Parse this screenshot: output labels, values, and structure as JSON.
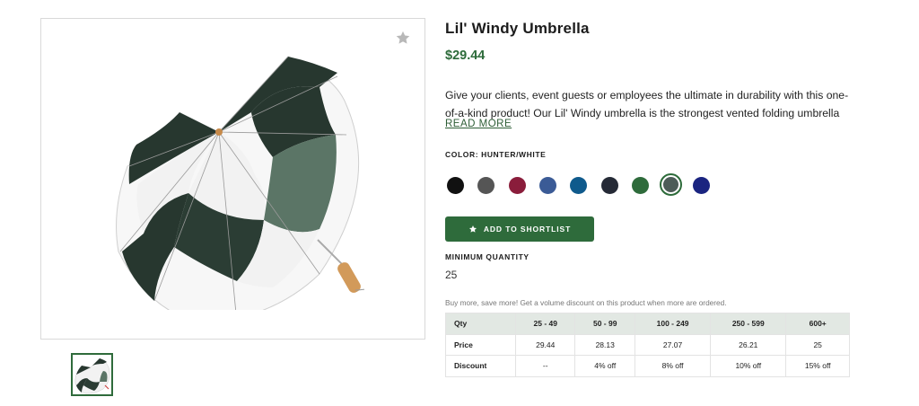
{
  "product": {
    "title": "Lil' Windy Umbrella",
    "price": "$29.44",
    "description": "Give your clients, event guests or employees the ultimate in durability with this one-of-a-kind product! Our Lil' Windy umbrella is the strongest vented folding umbrella i…",
    "read_more": "READ MORE"
  },
  "gallery": {
    "favorite_icon": "star-icon",
    "main_image": "umbrella-hunter-white",
    "thumbnail": "umbrella-thumbnail"
  },
  "color": {
    "label": "COLOR: HUNTER/WHITE",
    "selected": "hunter-white",
    "swatches": [
      {
        "name": "black",
        "hex": "#111111"
      },
      {
        "name": "gray",
        "hex": "#555555"
      },
      {
        "name": "burgundy",
        "hex": "#8a1d3b"
      },
      {
        "name": "royal",
        "hex": "#3b5b96"
      },
      {
        "name": "blue",
        "hex": "#0f5a8c"
      },
      {
        "name": "navy-dark",
        "hex": "#252a36"
      },
      {
        "name": "hunter",
        "hex": "#2e6b3b"
      },
      {
        "name": "hunter-white",
        "hex": "#4d5c58"
      },
      {
        "name": "navy",
        "hex": "#1a2480"
      }
    ]
  },
  "shortlist_button": {
    "label": "ADD TO SHORTLIST",
    "icon": "star-icon"
  },
  "minimum_quantity": {
    "label": "MINIMUM QUANTITY",
    "value": "25"
  },
  "volume_note": "Buy more, save more! Get a volume discount on this product when more are ordered.",
  "pricing_table": {
    "header": [
      "Qty",
      "25 - 49",
      "50 - 99",
      "100 - 249",
      "250 - 599",
      "600+"
    ],
    "rows": [
      [
        "Price",
        "29.44",
        "28.13",
        "27.07",
        "26.21",
        "25"
      ],
      [
        "Discount",
        "--",
        "4% off",
        "8% off",
        "10% off",
        "15% off"
      ]
    ]
  },
  "colors": {
    "brand_green": "#2e6b3b",
    "price_green": "#2d6b3a",
    "table_header_bg": "#e2e8e3"
  }
}
